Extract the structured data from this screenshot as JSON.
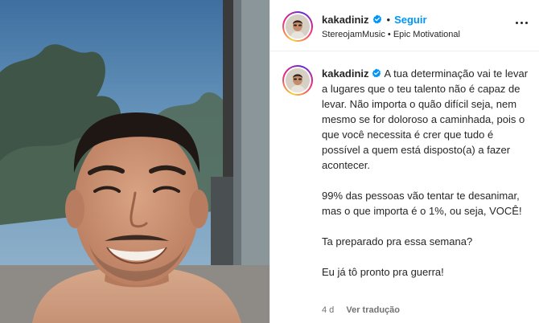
{
  "post": {
    "username": "kakadiniz",
    "follow_label": "Seguir",
    "separator": "•",
    "audio": "StereojamMusic • Epic Motivational",
    "caption_username": "kakadiniz",
    "caption_text": "A tua determinação vai te levar a lugares que o teu talento não é capaz de levar. Não importa o quão difícil seja, nem mesmo se for doloroso a caminhada, pois o que você necessita é crer que tudo é possível a quem está disposto(a) a fazer acontecer.\n\n99% das pessoas vão tentar te desanimar, mas o que importa é o 1%, ou seja, VOCÊ!\n\nTa preparado pra essa semana?\n\nEu já tô pronto pra guerra!",
    "age": "4 d",
    "translate_label": "Ver tradução"
  },
  "icons": {
    "verified": "verified-badge-icon",
    "more": "more-options-icon"
  },
  "colors": {
    "accent": "#0095f6",
    "verified": "#0095f6",
    "text": "#262626",
    "muted": "#737373"
  }
}
